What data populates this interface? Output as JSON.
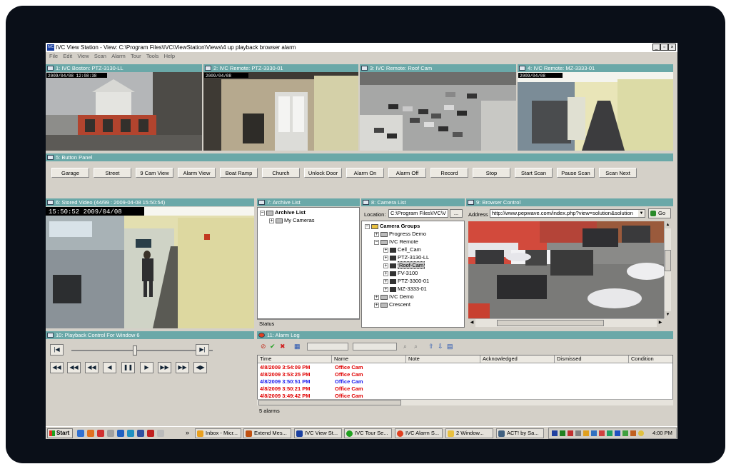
{
  "window": {
    "title": "IVC View Station - View: C:\\Program Files\\IVC\\ViewStation\\Views\\4 up playback browser alarm",
    "app_icon_label": "IVC"
  },
  "menu": [
    "File",
    "Edit",
    "View",
    "Scan",
    "Alarm",
    "Tour",
    "Tools",
    "Help"
  ],
  "cameras": [
    {
      "title": "1: IVC Boston: PTZ-3130-LL",
      "timestamp": "2009/04/08 12:08:38"
    },
    {
      "title": "2: IVC Remote: PTZ-3330-01",
      "timestamp": "2009/04/08"
    },
    {
      "title": "3: IVC Remote: Roof Cam",
      "timestamp": ""
    },
    {
      "title": "4: IVC Remote: MZ-3333-01",
      "timestamp": "2009/04/08"
    }
  ],
  "button_panel": {
    "title": "5: Button Panel",
    "buttons": [
      "Garage",
      "Street",
      "9 Cam View",
      "Alarm View",
      "Boat Ramp",
      "Church",
      "Unlock Door",
      "Alarm On",
      "Alarm Off",
      "Record",
      "Stop",
      "Start Scan",
      "Pause Scan",
      "Scan Next"
    ]
  },
  "stored_video": {
    "title": "6: Stored Video (44/99 : 2009-04-08 15:50:54)",
    "overlay": "15:50:52  2009/04/08"
  },
  "archive_list": {
    "title": "7: Archive List",
    "root": "Archive List",
    "child": "My Cameras",
    "status": "Status"
  },
  "camera_list": {
    "title": "8: Camera List",
    "location_label": "Location:",
    "location_value": "C:\\Program Files\\IVC\\V",
    "browse_label": "...",
    "root": "Camera Groups",
    "items": [
      {
        "label": "Progress Demo",
        "level": 1,
        "kind": "group"
      },
      {
        "label": "IVC Remote",
        "level": 1,
        "kind": "group",
        "expanded": true
      },
      {
        "label": "Cell_Cam",
        "level": 2,
        "kind": "cam"
      },
      {
        "label": "PTZ-3130-LL",
        "level": 2,
        "kind": "cam"
      },
      {
        "label": "Roof-Cam",
        "level": 2,
        "kind": "cam",
        "selected": true
      },
      {
        "label": "FV-3100",
        "level": 2,
        "kind": "cam"
      },
      {
        "label": "PTZ-3300-01",
        "level": 2,
        "kind": "cam"
      },
      {
        "label": "MZ-3333-01",
        "level": 2,
        "kind": "cam"
      },
      {
        "label": "IVC Demo",
        "level": 1,
        "kind": "group"
      },
      {
        "label": "Crescent",
        "level": 1,
        "kind": "group"
      }
    ]
  },
  "browser": {
    "title": "9: Browser Control",
    "address_label": "Address",
    "url": "http://www.pepwave.com/index.php?view=solution&solution",
    "go_label": "Go"
  },
  "playback": {
    "title": "10: Playback Control For Window 6",
    "slider_fraction": 0.45
  },
  "alarm_log": {
    "title": "11: Alarm Log",
    "columns": [
      "Time",
      "Name",
      "Note",
      "Acknowledged",
      "Dismissed",
      "Condition"
    ],
    "rows": [
      {
        "time": "4/8/2009 3:54:09 PM",
        "name": "Office Cam",
        "color": "#e00000"
      },
      {
        "time": "4/8/2009 3:53:25 PM",
        "name": "Office Cam",
        "color": "#e00000"
      },
      {
        "time": "4/8/2009 3:50:51 PM",
        "name": "Office Cam",
        "color": "#1a1aee"
      },
      {
        "time": "4/8/2009 3:50:21 PM",
        "name": "Office Cam",
        "color": "#e00000"
      },
      {
        "time": "4/8/2009 3:49:42 PM",
        "name": "Office Cam",
        "color": "#e00000"
      }
    ],
    "status": "5 alarms"
  },
  "taskbar": {
    "start_label": "Start",
    "chevron": "»",
    "tasks": [
      {
        "label": "Inbox - Micr...",
        "icon_color": "#e8a020"
      },
      {
        "label": "Extend Mes...",
        "icon_color": "#c05010"
      },
      {
        "label": "IVC View St...",
        "icon_color": "#1a3fa0"
      },
      {
        "label": "IVC Tour Se...",
        "icon_color": "#20a020"
      },
      {
        "label": "IVC Alarm S...",
        "icon_color": "#e04020"
      },
      {
        "label": "2 Window...",
        "icon_color": "#e8c040"
      },
      {
        "label": "ACT! by Sa...",
        "icon_color": "#406080"
      }
    ],
    "clock": "4:00 PM"
  }
}
